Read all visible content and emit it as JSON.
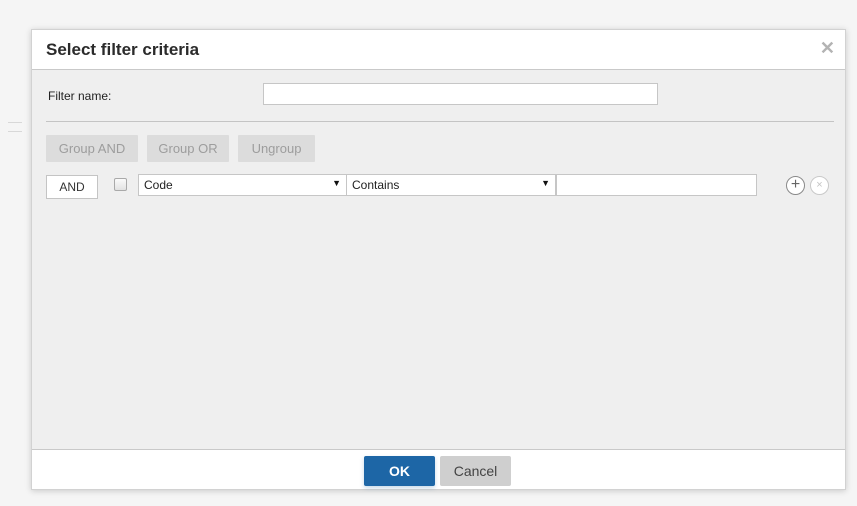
{
  "dialog": {
    "title": "Select filter criteria",
    "close_symbol": "✕",
    "close_icon": "close-icon"
  },
  "filter_name": {
    "label": "Filter name:",
    "value": "",
    "placeholder": ""
  },
  "grouping": {
    "group_and_label": "Group AND",
    "group_or_label": "Group OR",
    "ungroup_label": "Ungroup",
    "disabled_color": "#9d9d9d"
  },
  "criteria": [
    {
      "logic_label": "AND",
      "checked": false,
      "field": "Code",
      "operator": "Contains",
      "value": ""
    }
  ],
  "row_actions": {
    "add_symbol": "+",
    "add_icon": "plus-circle-icon",
    "remove_symbol": "×",
    "remove_icon": "remove-circle-icon"
  },
  "footer": {
    "ok_label": "OK",
    "cancel_label": "Cancel"
  },
  "colors": {
    "primary": "#1d66a6",
    "secondary": "#cfcfcf"
  }
}
